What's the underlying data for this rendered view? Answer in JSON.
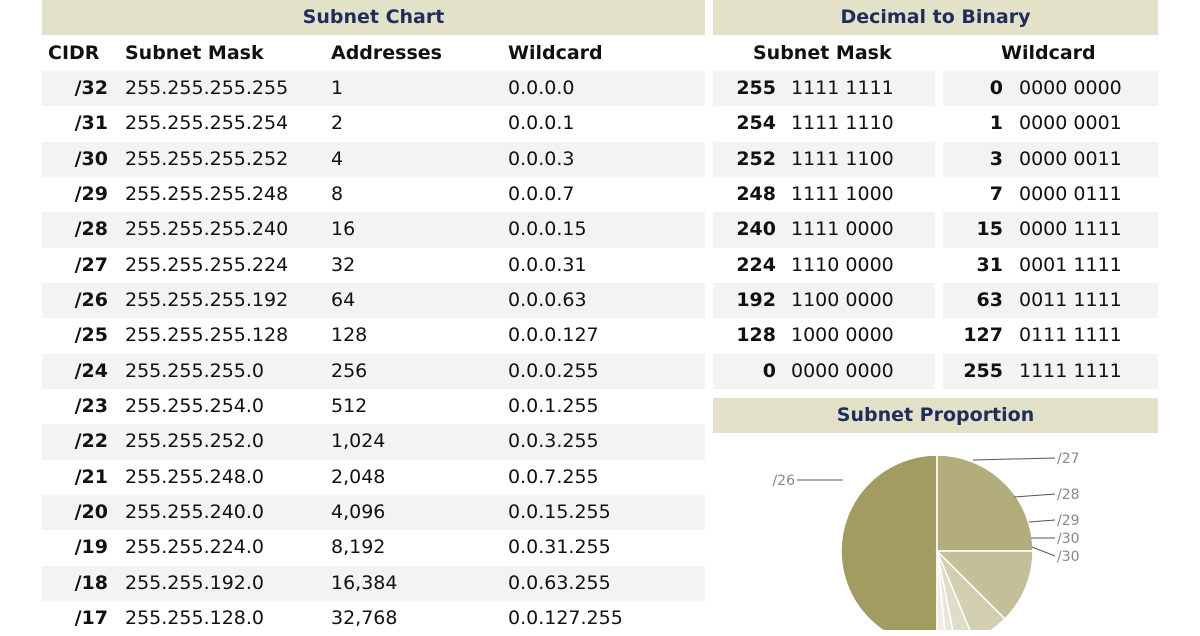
{
  "subnet_chart": {
    "title": "Subnet Chart",
    "headers": {
      "cidr": "CIDR",
      "mask": "Subnet Mask",
      "addresses": "Addresses",
      "wildcard": "Wildcard"
    },
    "rows": [
      {
        "cidr": "/32",
        "mask": "255.255.255.255",
        "addresses": "1",
        "wildcard": "0.0.0.0"
      },
      {
        "cidr": "/31",
        "mask": "255.255.255.254",
        "addresses": "2",
        "wildcard": "0.0.0.1"
      },
      {
        "cidr": "/30",
        "mask": "255.255.255.252",
        "addresses": "4",
        "wildcard": "0.0.0.3"
      },
      {
        "cidr": "/29",
        "mask": "255.255.255.248",
        "addresses": "8",
        "wildcard": "0.0.0.7"
      },
      {
        "cidr": "/28",
        "mask": "255.255.255.240",
        "addresses": "16",
        "wildcard": "0.0.0.15"
      },
      {
        "cidr": "/27",
        "mask": "255.255.255.224",
        "addresses": "32",
        "wildcard": "0.0.0.31"
      },
      {
        "cidr": "/26",
        "mask": "255.255.255.192",
        "addresses": "64",
        "wildcard": "0.0.0.63"
      },
      {
        "cidr": "/25",
        "mask": "255.255.255.128",
        "addresses": "128",
        "wildcard": "0.0.0.127"
      },
      {
        "cidr": "/24",
        "mask": "255.255.255.0",
        "addresses": "256",
        "wildcard": "0.0.0.255"
      },
      {
        "cidr": "/23",
        "mask": "255.255.254.0",
        "addresses": "512",
        "wildcard": "0.0.1.255"
      },
      {
        "cidr": "/22",
        "mask": "255.255.252.0",
        "addresses": "1,024",
        "wildcard": "0.0.3.255"
      },
      {
        "cidr": "/21",
        "mask": "255.255.248.0",
        "addresses": "2,048",
        "wildcard": "0.0.7.255"
      },
      {
        "cidr": "/20",
        "mask": "255.255.240.0",
        "addresses": "4,096",
        "wildcard": "0.0.15.255"
      },
      {
        "cidr": "/19",
        "mask": "255.255.224.0",
        "addresses": "8,192",
        "wildcard": "0.0.31.255"
      },
      {
        "cidr": "/18",
        "mask": "255.255.192.0",
        "addresses": "16,384",
        "wildcard": "0.0.63.255"
      },
      {
        "cidr": "/17",
        "mask": "255.255.128.0",
        "addresses": "32,768",
        "wildcard": "0.0.127.255"
      }
    ]
  },
  "binary_table": {
    "title": "Decimal to Binary",
    "headers": {
      "mask": "Subnet Mask",
      "wildcard": "Wildcard"
    },
    "rows": [
      {
        "mask_dec": "255",
        "mask_bin": "1111 1111",
        "wild_dec": "0",
        "wild_bin": "0000 0000"
      },
      {
        "mask_dec": "254",
        "mask_bin": "1111 1110",
        "wild_dec": "1",
        "wild_bin": "0000 0001"
      },
      {
        "mask_dec": "252",
        "mask_bin": "1111 1100",
        "wild_dec": "3",
        "wild_bin": "0000 0011"
      },
      {
        "mask_dec": "248",
        "mask_bin": "1111 1000",
        "wild_dec": "7",
        "wild_bin": "0000 0111"
      },
      {
        "mask_dec": "240",
        "mask_bin": "1111 0000",
        "wild_dec": "15",
        "wild_bin": "0000 1111"
      },
      {
        "mask_dec": "224",
        "mask_bin": "1110 0000",
        "wild_dec": "31",
        "wild_bin": "0001 1111"
      },
      {
        "mask_dec": "192",
        "mask_bin": "1100 0000",
        "wild_dec": "63",
        "wild_bin": "0011 1111"
      },
      {
        "mask_dec": "128",
        "mask_bin": "1000 0000",
        "wild_dec": "127",
        "wild_bin": "0111 1111"
      },
      {
        "mask_dec": "0",
        "mask_bin": "0000 0000",
        "wild_dec": "255",
        "wild_bin": "1111 1111"
      }
    ]
  },
  "proportion": {
    "title": "Subnet Proportion",
    "colors": {
      "half": "#a29c62",
      "quarter": "#b3ad7c",
      "eighth": "#c4bf98",
      "sixteenth": "#d3cfb1",
      "small1": "#deddc9",
      "small2": "#e7e6d8",
      "small3": "#efeee4",
      "edge": "#ffffff",
      "leader": "#555555"
    },
    "slices": [
      {
        "label": "",
        "fraction": 0.5,
        "color_key": "half"
      },
      {
        "label": "/26",
        "fraction": 0.25,
        "color_key": "quarter"
      },
      {
        "label": "/27",
        "fraction": 0.125,
        "color_key": "eighth"
      },
      {
        "label": "/28",
        "fraction": 0.0625,
        "color_key": "sixteenth"
      },
      {
        "label": "/29",
        "fraction": 0.03125,
        "color_key": "small1"
      },
      {
        "label": "/30",
        "fraction": 0.015625,
        "color_key": "small2"
      },
      {
        "label": "/30",
        "fraction": 0.015625,
        "color_key": "small3"
      }
    ]
  }
}
